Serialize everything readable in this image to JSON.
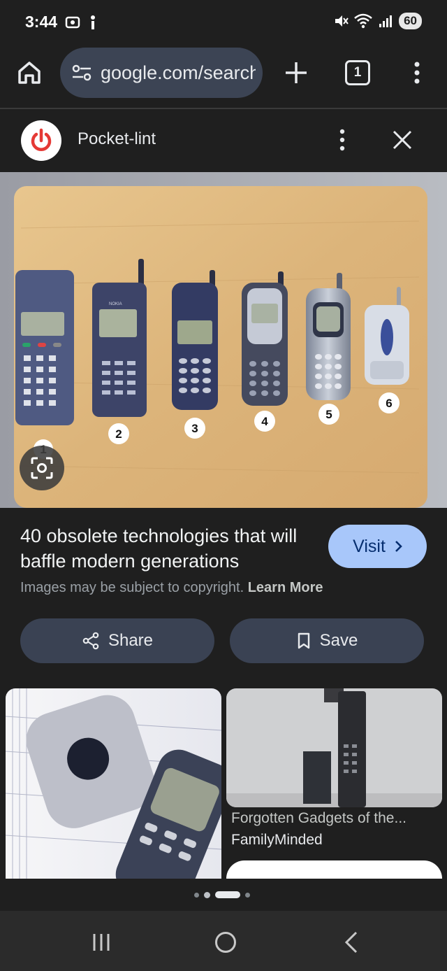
{
  "status_bar": {
    "time": "3:44",
    "battery": "60",
    "icons": [
      "screenshot-icon",
      "alert-icon",
      "mute-icon",
      "wifi-icon",
      "signal-icon"
    ]
  },
  "browser": {
    "url": "google.com/search",
    "tab_count": "1"
  },
  "source": {
    "name": "Pocket-lint",
    "brand_color": "#e53935"
  },
  "hero": {
    "phone_numbers": [
      "1",
      "2",
      "3",
      "4",
      "5",
      "6"
    ],
    "brand_label": "NOKIA"
  },
  "result": {
    "title": "40 obsolete technologies that will baffle modern generations",
    "visit_label": "Visit",
    "copyright_text": "Images may be subject to copyright.",
    "learn_more": "Learn More",
    "share_label": "Share",
    "save_label": "Save"
  },
  "related": {
    "caption": "Forgotten Gadgets of the...",
    "source": "FamilyMinded"
  },
  "colors": {
    "background": "#1f1f1f",
    "pill": "#3a4253",
    "visit": "#a8c7fa"
  }
}
